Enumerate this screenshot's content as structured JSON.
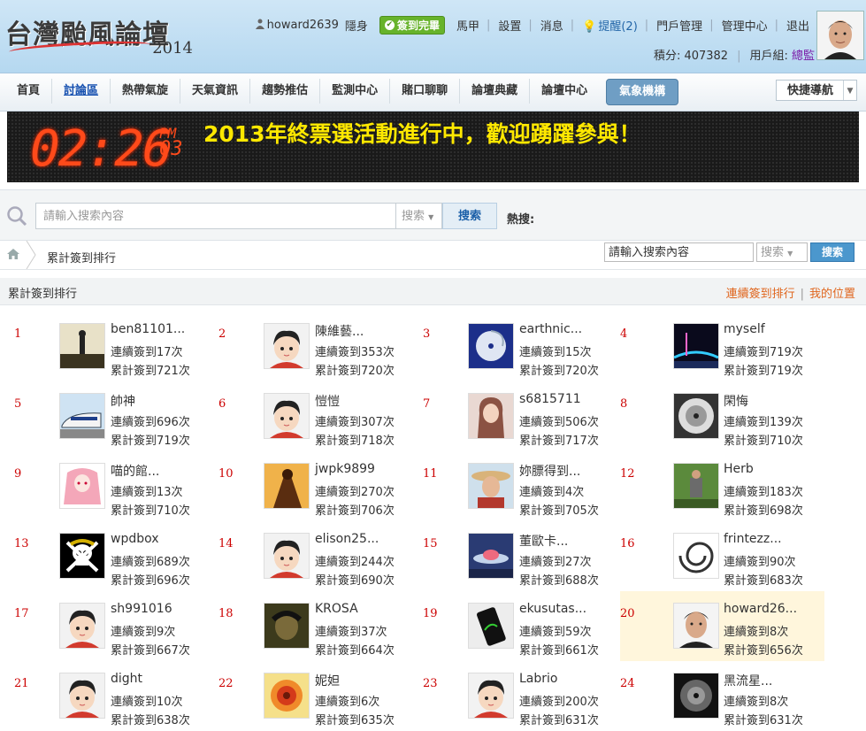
{
  "header": {
    "logo_title": "台灣颱風論壇",
    "logo_year": "2014",
    "username": "howard2639",
    "stealth": "隱身",
    "signed_label": "簽到完畢",
    "links": [
      "馬甲",
      "設置",
      "消息"
    ],
    "remind_label": "提醒(2)",
    "links2": [
      "門戶管理",
      "管理中心",
      "退出"
    ],
    "points_label": "積分: 407382",
    "group_prefix": "用戶組: ",
    "group_value": "總監"
  },
  "nav": {
    "items": [
      "首頁",
      "討論區",
      "熱帶氣旋",
      "天氣資訊",
      "趨勢推估",
      "監測中心",
      "賭口聊聊",
      "論壇典藏",
      "論壇中心",
      "氣象機構"
    ],
    "quick_nav": "快捷導航"
  },
  "banner": {
    "time": "02:26",
    "ampm": "PM",
    "day": "03",
    "message": "2013年終票選活動進行中，歡迎踴躍參與！"
  },
  "search": {
    "placeholder": "請輸入搜索內容",
    "type_label": "搜索",
    "button": "搜索",
    "hot_label": "熱搜:"
  },
  "breadcrumb": {
    "current": "累計簽到排行",
    "input_value": "請輸入搜索內容",
    "select_label": "搜索",
    "button": "搜索"
  },
  "section": {
    "title": "累計簽到排行",
    "link1": "連續簽到排行",
    "link2": "我的位置"
  },
  "ranking": [
    {
      "rank": "1",
      "name": "ben81101...",
      "streak": "連續簽到17次",
      "total": "累計簽到721次",
      "thumb": "silhouette"
    },
    {
      "rank": "2",
      "name": "陳維藝...",
      "streak": "連續簽到353次",
      "total": "累計簽到720次",
      "thumb": "default"
    },
    {
      "rank": "3",
      "name": "earthnic...",
      "streak": "連續簽到15次",
      "total": "累計簽到720次",
      "thumb": "typhoon-blue"
    },
    {
      "rank": "4",
      "name": "myself",
      "streak": "連續簽到719次",
      "total": "累計簽到719次",
      "thumb": "bridge-night"
    },
    {
      "rank": "5",
      "name": "帥神",
      "streak": "連續簽到696次",
      "total": "累計簽到719次",
      "thumb": "train"
    },
    {
      "rank": "6",
      "name": "愷愷",
      "streak": "連續簽到307次",
      "total": "累計簽到718次",
      "thumb": "default"
    },
    {
      "rank": "7",
      "name": "s6815711",
      "streak": "連續簽到506次",
      "total": "累計簽到717次",
      "thumb": "girl"
    },
    {
      "rank": "8",
      "name": "閑悔",
      "streak": "連續簽到139次",
      "total": "累計簽到710次",
      "thumb": "typhoon-gray"
    },
    {
      "rank": "9",
      "name": "喵的館...",
      "streak": "連續簽到13次",
      "total": "累計簽到710次",
      "thumb": "anime"
    },
    {
      "rank": "10",
      "name": "jwpk9899",
      "streak": "連續簽到270次",
      "total": "累計簽到706次",
      "thumb": "warrior"
    },
    {
      "rank": "11",
      "name": "妳膘得到...",
      "streak": "連續簽到4次",
      "total": "累計簽到705次",
      "thumb": "hat-man"
    },
    {
      "rank": "12",
      "name": "Herb",
      "streak": "連續簽到183次",
      "total": "累計簽到698次",
      "thumb": "park-man"
    },
    {
      "rank": "13",
      "name": "wpdbox",
      "streak": "連續簽到689次",
      "total": "累計簽到696次",
      "thumb": "skull"
    },
    {
      "rank": "14",
      "name": "elison25...",
      "streak": "連續簽到244次",
      "total": "累計簽到690次",
      "thumb": "default"
    },
    {
      "rank": "15",
      "name": "董歐卡...",
      "streak": "連續簽到27次",
      "total": "累計簽到688次",
      "thumb": "ufo"
    },
    {
      "rank": "16",
      "name": "frintezz...",
      "streak": "連續簽到90次",
      "total": "累計簽到683次",
      "thumb": "typhoon-bw"
    },
    {
      "rank": "17",
      "name": "sh991016",
      "streak": "連續簽到9次",
      "total": "累計簽到667次",
      "thumb": "default"
    },
    {
      "rank": "18",
      "name": "KROSA",
      "streak": "連續簽到37次",
      "total": "累計簽到664次",
      "thumb": "dark-face"
    },
    {
      "rank": "19",
      "name": "ekusutas...",
      "streak": "連續簽到59次",
      "total": "累計簽到661次",
      "thumb": "phone"
    },
    {
      "rank": "20",
      "name": "howard26...",
      "streak": "連續簽到8次",
      "total": "累計簽到656次",
      "thumb": "face",
      "me": true
    },
    {
      "rank": "21",
      "name": "dight",
      "streak": "連續簽到10次",
      "total": "累計簽到638次",
      "thumb": "default"
    },
    {
      "rank": "22",
      "name": "妮妲",
      "streak": "連續簽到6次",
      "total": "累計簽到635次",
      "thumb": "radar"
    },
    {
      "rank": "23",
      "name": "Labrio",
      "streak": "連續簽到200次",
      "total": "累計簽到631次",
      "thumb": "default"
    },
    {
      "rank": "24",
      "name": "黑流星...",
      "streak": "連續簽到8次",
      "total": "累計簽到631次",
      "thumb": "typhoon-dark"
    }
  ]
}
